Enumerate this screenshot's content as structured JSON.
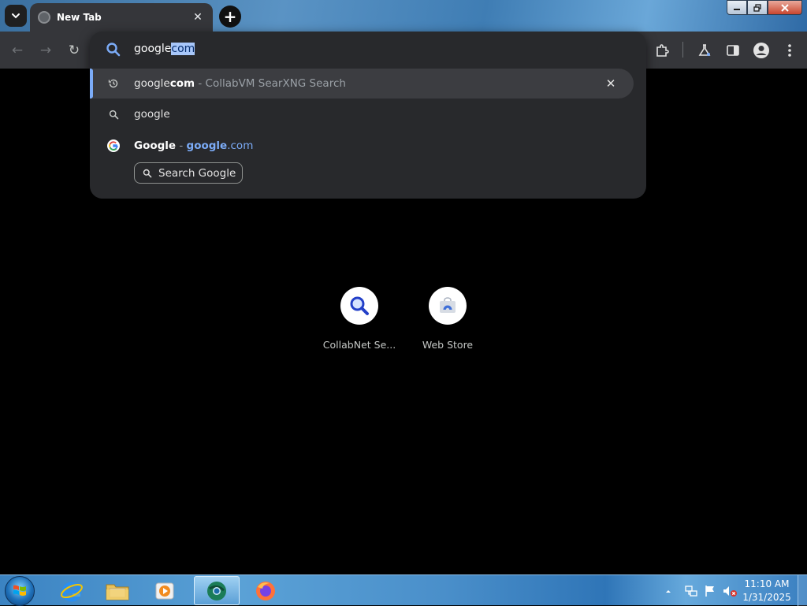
{
  "window": {
    "tab_title": "New Tab",
    "new_tab_symbol": "+",
    "tab_close_symbol": "✕"
  },
  "toolbar": {
    "back_symbol": "←",
    "forward_symbol": "→",
    "reload_symbol": "↻"
  },
  "omnibox": {
    "typed_text": "google",
    "autocomplete_text": "com",
    "suggestions": [
      {
        "icon": "history-icon",
        "primary_plain": "google",
        "primary_bold": "com",
        "separator": " - ",
        "secondary": "CollabVM SearXNG Search",
        "remove_symbol": "✕"
      },
      {
        "icon": "search-icon",
        "primary_plain": "google"
      },
      {
        "icon": "google-g-icon",
        "primary_bold": "Google",
        "separator": " - ",
        "url_bold": "google",
        "url_rest": ".com"
      }
    ],
    "action_chip_label": "Search Google"
  },
  "shortcuts": [
    {
      "label": "CollabNet Se...",
      "icon": "collabnet-search-icon"
    },
    {
      "label": "Web Store",
      "icon": "web-store-icon"
    }
  ],
  "taskbar": {
    "apps": [
      "internet-explorer-icon",
      "file-explorer-icon",
      "media-player-icon",
      "chrome-icon",
      "firefox-icon"
    ],
    "clock_time": "11:10 AM",
    "clock_date": "1/31/2025"
  },
  "colors": {
    "accent": "#7cacf8",
    "omnibox_bg": "#28292c",
    "toolbar_bg": "#35363a"
  }
}
